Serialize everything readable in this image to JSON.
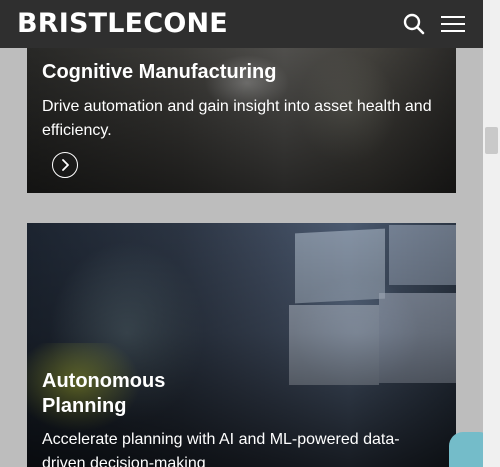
{
  "header": {
    "logo_text": "BRISTLECONE",
    "search_icon": "search-icon",
    "menu_icon": "hamburger-menu-icon",
    "background_color": "#2f2f2f"
  },
  "cards": [
    {
      "title": "Cognitive Manufacturing",
      "description": "Drive automation and gain insight into asset health and efficiency.",
      "link_icon": "chevron-right-circle-icon"
    },
    {
      "title": "Autonomous Planning",
      "description": "Accelerate planning with AI and ML-powered data-driven decision-making"
    }
  ],
  "chat_widget": {
    "icon": "chat-icon",
    "color": "#74bcc9"
  }
}
